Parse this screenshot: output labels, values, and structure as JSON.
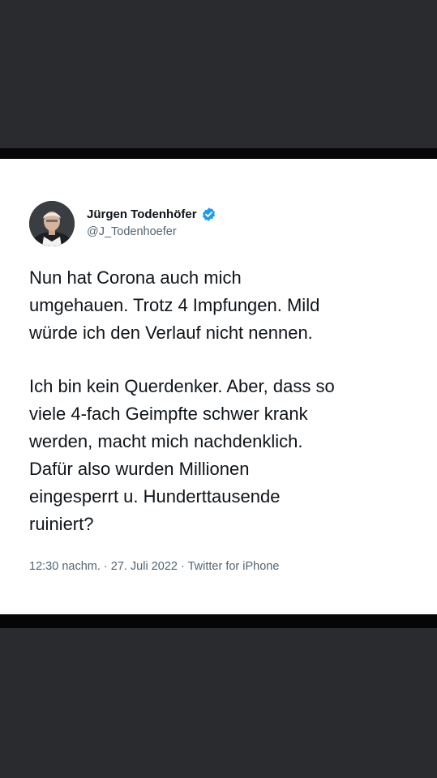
{
  "tweet": {
    "author_name": "Jürgen Todenhöfer",
    "handle": "@J_Todenhoefer",
    "verified": true,
    "text_lines_p1": [
      "Nun hat Corona auch mich",
      "umgehauen. Trotz 4 Impfungen. Mild",
      "würde ich den Verlauf nicht nennen."
    ],
    "text_lines_p2": [
      "Ich bin kein Querdenker. Aber, dass so",
      "viele 4-fach Geimpfte schwer krank",
      "werden, macht mich nachdenklich.",
      "Dafür also wurden Millionen",
      "eingesperrt u. Hunderttausende",
      "ruiniert?"
    ],
    "meta": "12:30 nachm. · 27. Juli 2022 · Twitter for iPhone"
  },
  "colors": {
    "background": "#2a2b2f",
    "bands": "#060606",
    "card": "#ffffff",
    "text_primary": "#0f1419",
    "text_secondary": "#536471",
    "verified_blue": "#1d9bf0"
  },
  "icons": {
    "verified": "verified-badge-icon",
    "avatar": "profile-photo"
  }
}
